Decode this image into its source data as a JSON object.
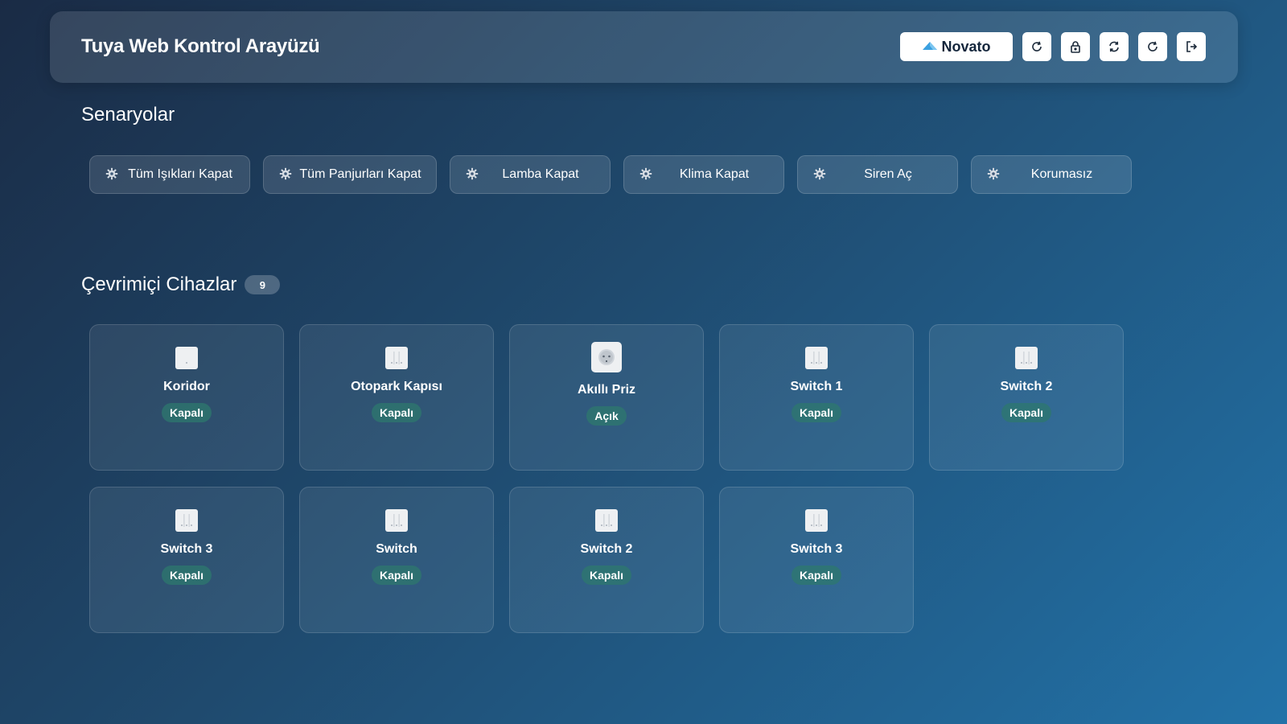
{
  "header": {
    "title": "Tuya Web Kontrol Arayüzü",
    "brand_label": "Novato",
    "actions": [
      {
        "name": "refresh-button",
        "icon": "refresh-icon"
      },
      {
        "name": "lock-button",
        "icon": "lock-icon"
      },
      {
        "name": "sync-button",
        "icon": "sync-icon"
      },
      {
        "name": "reload-button",
        "icon": "reload-icon"
      },
      {
        "name": "logout-button",
        "icon": "logout-icon"
      }
    ]
  },
  "scenes": {
    "title": "Senaryolar",
    "items": [
      {
        "label": "Tüm Işıkları Kapat",
        "icon": "gear-icon"
      },
      {
        "label": "Tüm Panjurları Kapat",
        "icon": "gear-icon"
      },
      {
        "label": "Lamba Kapat",
        "icon": "gear-icon"
      },
      {
        "label": "Klima Kapat",
        "icon": "gear-icon"
      },
      {
        "label": "Siren Aç",
        "icon": "gear-icon"
      },
      {
        "label": "Korumasız",
        "icon": "gear-icon"
      }
    ]
  },
  "devices": {
    "title": "Çevrimiçi Cihazlar",
    "count": "9",
    "items": [
      {
        "name": "Koridor",
        "state": "Kapalı",
        "icon": "switch-icon"
      },
      {
        "name": "Otopark Kapısı",
        "state": "Kapalı",
        "icon": "switch-icon"
      },
      {
        "name": "Akıllı Priz",
        "state": "Açık",
        "icon": "socket-icon"
      },
      {
        "name": "Switch 1",
        "state": "Kapalı",
        "icon": "switch-icon"
      },
      {
        "name": "Switch 2",
        "state": "Kapalı",
        "icon": "switch-icon"
      },
      {
        "name": "Switch 3",
        "state": "Kapalı",
        "icon": "switch-icon"
      },
      {
        "name": "Switch",
        "state": "Kapalı",
        "icon": "switch-icon"
      },
      {
        "name": "Switch 2",
        "state": "Kapalı",
        "icon": "switch-icon"
      },
      {
        "name": "Switch 3",
        "state": "Kapalı",
        "icon": "switch-icon"
      }
    ]
  },
  "colors": {
    "background_start": "#1a2b45",
    "background_end": "#2272a8",
    "state_badge": "#2e786e",
    "brand_icon": "#3aa0e0"
  }
}
